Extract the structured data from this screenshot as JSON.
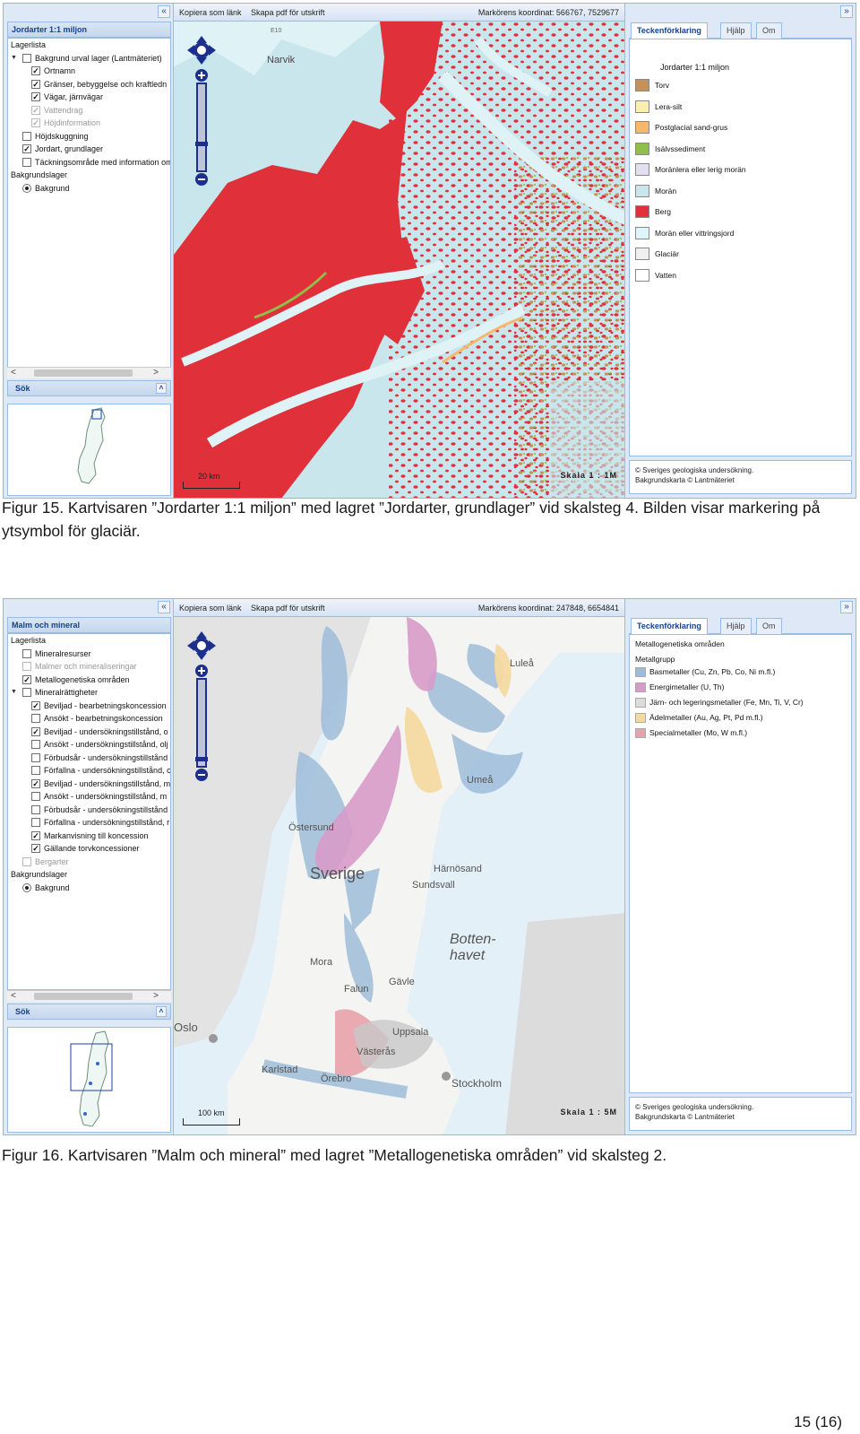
{
  "figure1": {
    "panel_title": "Jordarter 1:1 miljon",
    "layers": [
      {
        "label": "Lagerlista",
        "kind": "header"
      },
      {
        "label": "Bakgrund urval lager (Lantmäteriet)",
        "kind": "group",
        "checked": false
      },
      {
        "label": "Ortnamn",
        "kind": "item",
        "checked": true
      },
      {
        "label": "Gränser, bebyggelse och kraftledn",
        "kind": "item",
        "checked": true
      },
      {
        "label": "Vägar, järnvägar",
        "kind": "item",
        "checked": true
      },
      {
        "label": "Vattendrag",
        "kind": "item",
        "checked": true,
        "dim": true
      },
      {
        "label": "Höjdinformation",
        "kind": "item",
        "checked": true,
        "dim": true
      },
      {
        "label": "Höjdskuggning",
        "kind": "top",
        "checked": false
      },
      {
        "label": "Jordart, grundlager",
        "kind": "top",
        "checked": true
      },
      {
        "label": "Täckningsområde med information om",
        "kind": "top",
        "checked": false
      },
      {
        "label": "Bakgrundslager",
        "kind": "header"
      },
      {
        "label": "Bakgrund",
        "kind": "radio"
      }
    ],
    "toolbar": {
      "copy_link": "Kopiera som länk",
      "pdf": "Skapa pdf för utskrift",
      "coord": "Markörens koordinat: 566767, 7529677"
    },
    "search_label": "Sök",
    "scale_label": "Skala 1 : 1M",
    "scalebar_label": "20 km",
    "map_labels": {
      "narvik": "Narvik",
      "road": "E10"
    },
    "tabs": [
      "Teckenförklaring",
      "Hjälp",
      "Om"
    ],
    "legend_title": "Jordarter 1:1 miljon",
    "legend": [
      {
        "label": "Torv",
        "color": "#c4915c"
      },
      {
        "label": "Lera-silt",
        "color": "#fbeeb0"
      },
      {
        "label": "Postglacial sand-grus",
        "color": "#f8b86a"
      },
      {
        "label": "Isälvssediment",
        "color": "#8fbe4a"
      },
      {
        "label": "Moränlera eller lerig morän",
        "color": "#e3dfee"
      },
      {
        "label": "Morän",
        "color": "#c9e6ec"
      },
      {
        "label": "Berg",
        "color": "#e0303a"
      },
      {
        "label": "Morän eller vittringsjord",
        "color": "#dff6f8"
      },
      {
        "label": "Glaciär",
        "color": "#f0f0f0"
      },
      {
        "label": "Vatten",
        "color": "#ffffff"
      }
    ],
    "credits": [
      "© Sveriges geologiska undersökning.",
      "Bakgrundskarta © Lantmäteriet"
    ]
  },
  "caption1": "Figur 15. Kartvisaren ”Jordarter 1:1 miljon” med lagret ”Jordarter, grundlager” vid skalsteg 4. Bilden visar markering på ytsymbol för glaciär.",
  "figure2": {
    "panel_title": "Malm och mineral",
    "layers": [
      {
        "label": "Lagerlista",
        "kind": "header"
      },
      {
        "label": "Mineralresurser",
        "kind": "top",
        "checked": false
      },
      {
        "label": "Malmer och mineraliseringar",
        "kind": "top",
        "checked": false,
        "dim": true
      },
      {
        "label": "Metallogenetiska områden",
        "kind": "top",
        "checked": true
      },
      {
        "label": "Mineralrättigheter",
        "kind": "group",
        "checked": false
      },
      {
        "label": "Beviljad - bearbetningskoncession",
        "kind": "item",
        "checked": true
      },
      {
        "label": "Ansökt - bearbetningskoncession",
        "kind": "item",
        "checked": false
      },
      {
        "label": "Beviljad - undersökningstillstånd, o",
        "kind": "item",
        "checked": true
      },
      {
        "label": "Ansökt - undersökningstillstånd, olj",
        "kind": "item",
        "checked": false
      },
      {
        "label": "Förbudsår - undersökningstillstånd",
        "kind": "item",
        "checked": false
      },
      {
        "label": "Förfallna - undersökningstillstånd, c",
        "kind": "item",
        "checked": false
      },
      {
        "label": "Beviljad - undersökningstillstånd, m",
        "kind": "item",
        "checked": true
      },
      {
        "label": "Ansökt - undersökningstillstånd, m",
        "kind": "item",
        "checked": false
      },
      {
        "label": "Förbudsår - undersökningstillstånd",
        "kind": "item",
        "checked": false
      },
      {
        "label": "Förfallna - undersökningstillstånd, r",
        "kind": "item",
        "checked": false
      },
      {
        "label": "Markanvisning till koncession",
        "kind": "item",
        "checked": true
      },
      {
        "label": "Gällande torvkoncessioner",
        "kind": "item",
        "checked": true
      },
      {
        "label": "Bergarter",
        "kind": "top",
        "checked": false,
        "dim": true
      },
      {
        "label": "Bakgrundslager",
        "kind": "header"
      },
      {
        "label": "Bakgrund",
        "kind": "radio"
      }
    ],
    "toolbar": {
      "copy_link": "Kopiera som länk",
      "pdf": "Skapa pdf för utskrift",
      "coord": "Markörens koordinat: 247848, 6654841"
    },
    "search_label": "Sök",
    "scale_label": "Skala 1 : 5M",
    "scalebar_label": "100 km",
    "map_labels": {
      "lulea": "Luleå",
      "umea": "Umeå",
      "ostersund": "Östersund",
      "sverige": "Sverige",
      "harnosand": "Härnösand",
      "sundsvall": "Sundsvall",
      "bottenhavet_1": "Botten-",
      "bottenhavet_2": "havet",
      "mora": "Mora",
      "falun": "Falun",
      "gavle": "Gävle",
      "oslo": "Oslo",
      "uppsala": "Uppsala",
      "vasteras": "Västerås",
      "karlstad": "Karlstad",
      "orebro": "Örebro",
      "stockholm": "Stockholm"
    },
    "tabs": [
      "Teckenförklaring",
      "Hjälp",
      "Om"
    ],
    "legend_header_1": "Metallogenetiska områden",
    "legend_header_2": "Metallgrupp",
    "legend": [
      {
        "label": "Basmetaller (Cu, Zn, Pb, Co, Ni m.fl.)",
        "color": "#9dbcd9"
      },
      {
        "label": "Energimetaller (U, Th)",
        "color": "#d79bc9"
      },
      {
        "label": "Järn- och legeringsmetaller (Fe, Mn, Ti, V, Cr)",
        "color": "#dcdcdc"
      },
      {
        "label": "Ädelmetaller (Au, Ag, Pt, Pd m.fl.)",
        "color": "#f4d9a0"
      },
      {
        "label": "Specialmetaller (Mo, W m.fl.)",
        "color": "#e9a2ab"
      }
    ],
    "credits": [
      "© Sveriges geologiska undersökning.",
      "Bakgrundskarta © Lantmäteriet"
    ]
  },
  "caption2": "Figur 16. Kartvisaren ”Malm och mineral” med lagret ”Metallogenetiska områden” vid skalsteg 2.",
  "page_number": "15 (16)"
}
